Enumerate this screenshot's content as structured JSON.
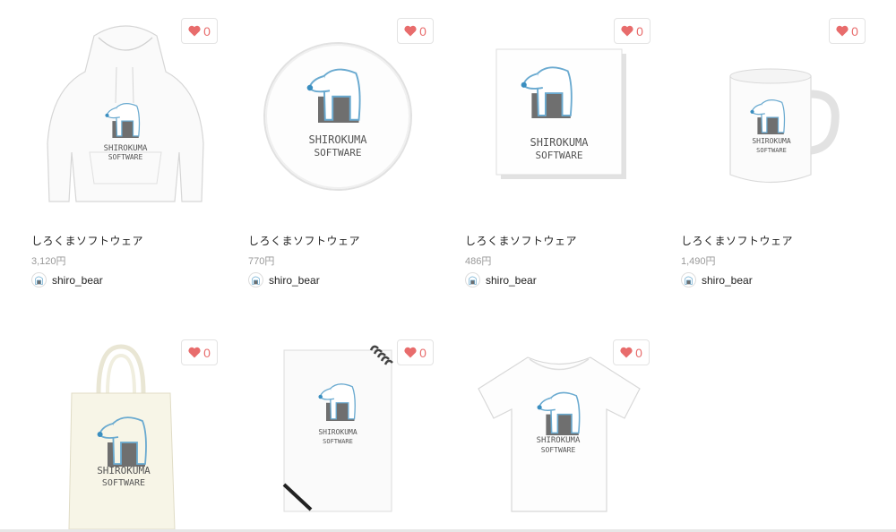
{
  "products": [
    {
      "title": "しろくまソフトウェア",
      "price": "3,120円",
      "seller": "shiro_bear",
      "likes": "0",
      "item": "hoodie-icon"
    },
    {
      "title": "しろくまソフトウェア",
      "price": "770円",
      "seller": "shiro_bear",
      "likes": "0",
      "item": "badge-icon"
    },
    {
      "title": "しろくまソフトウェア",
      "price": "486円",
      "seller": "shiro_bear",
      "likes": "0",
      "item": "sticker-icon"
    },
    {
      "title": "しろくまソフトウェア",
      "price": "1,490円",
      "seller": "shiro_bear",
      "likes": "0",
      "item": "mug-icon"
    },
    {
      "likes": "0",
      "item": "tote-bag-icon"
    },
    {
      "likes": "0",
      "item": "notebook-icon"
    },
    {
      "likes": "0",
      "item": "t-shirt-icon"
    }
  ],
  "logo": {
    "line1": "SHIROKUMA",
    "line2": "SOFTWARE"
  },
  "colors": {
    "heart": "#e86c6c",
    "bear_outline": "#6aaad0",
    "bear_nose": "#3a8ec0",
    "logo_text": "#555555",
    "block": "#6f6f6f"
  }
}
